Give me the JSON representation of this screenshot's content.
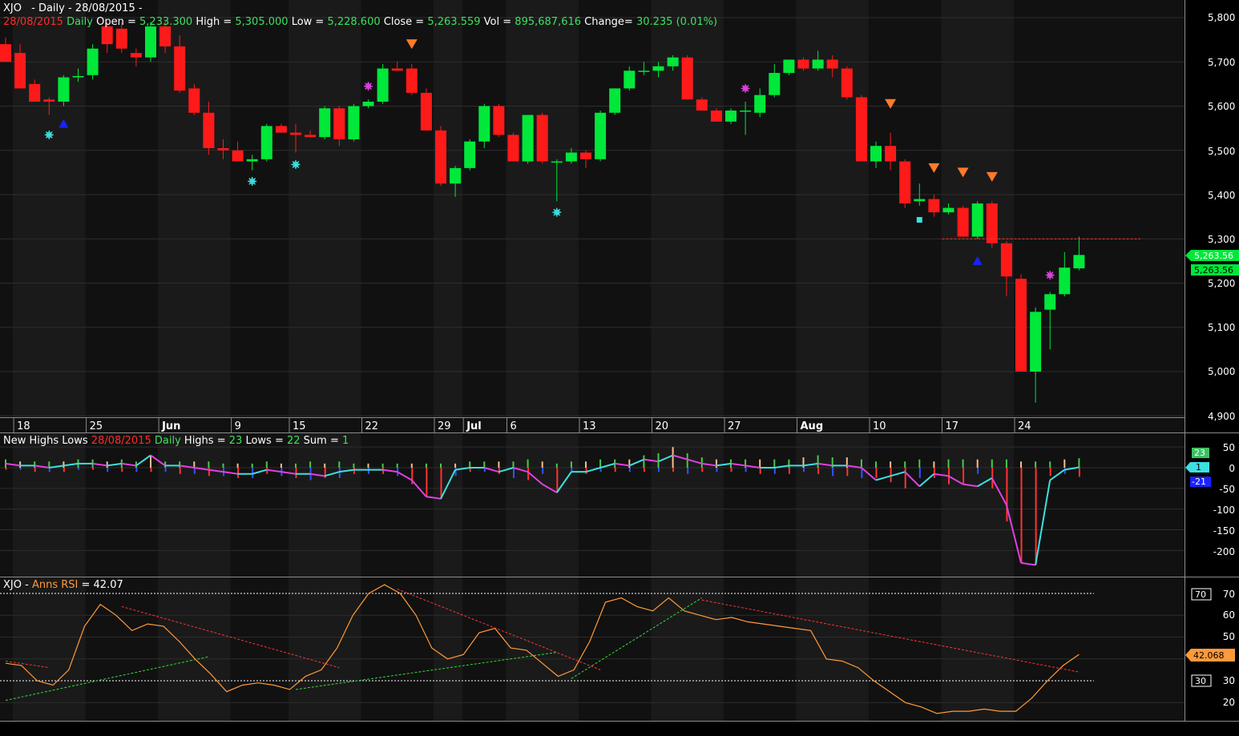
{
  "colors": {
    "background": "#000000",
    "panel_bg": "#111111",
    "stripe": "#1a1a1a",
    "border": "#8a8a8a",
    "grid": "#2d2d2d",
    "up": "#00e83a",
    "down": "#ff1a1a",
    "text": "#ffffff",
    "label_red": "#ff2a2a",
    "label_green": "#3ee060",
    "cyan": "#3de0e0",
    "magenta": "#e040e0",
    "orange": "#ff7a2a",
    "blue": "#1a22ff",
    "rsi_line": "#ff9a3a",
    "tick_pos": "#44cc44",
    "tick_neg": "#ff3333",
    "tick_peach": "#ffbb88",
    "tick_blue": "#3355ff"
  },
  "header": {
    "symbol": "XJO",
    "period": "- Daily - 28/08/2015 -"
  },
  "price_info": {
    "date": "28/08/2015",
    "interval": "Daily",
    "open_label": "Open =",
    "open": "5,233.300",
    "high_label": "High =",
    "high": "5,305.000",
    "low_label": "Low =",
    "low": "5,228.600",
    "close_label": "Close =",
    "close": "5,263.559",
    "vol_label": "Vol =",
    "vol": "895,687,616",
    "change_label": "Change=",
    "change": "30.235 (0.01%)"
  },
  "price_axis": {
    "ticks": [
      "5,800",
      "5,700",
      "5,600",
      "5,500",
      "5,400",
      "5,300",
      "5,200",
      "5,100",
      "5,000",
      "4,900"
    ],
    "last_badge_1": "5,263.56",
    "last_badge_2": "5,263.56"
  },
  "date_axis": [
    {
      "label": "18",
      "bar": 1,
      "bold": false
    },
    {
      "label": "25",
      "bar": 6,
      "bold": false
    },
    {
      "label": "Jun",
      "bar": 11,
      "bold": true
    },
    {
      "label": "9",
      "bar": 16,
      "bold": false
    },
    {
      "label": "15",
      "bar": 20,
      "bold": false
    },
    {
      "label": "22",
      "bar": 25,
      "bold": false
    },
    {
      "label": "29",
      "bar": 30,
      "bold": false
    },
    {
      "label": "Jul",
      "bar": 32,
      "bold": true
    },
    {
      "label": "6",
      "bar": 35,
      "bold": false
    },
    {
      "label": "13",
      "bar": 40,
      "bold": false
    },
    {
      "label": "20",
      "bar": 45,
      "bold": false
    },
    {
      "label": "27",
      "bar": 50,
      "bold": false
    },
    {
      "label": "Aug",
      "bar": 55,
      "bold": true
    },
    {
      "label": "10",
      "bar": 60,
      "bold": false
    },
    {
      "label": "17",
      "bar": 65,
      "bold": false
    },
    {
      "label": "24",
      "bar": 70,
      "bold": false
    }
  ],
  "highs_lows_panel": {
    "title": "New Highs Lows",
    "date": "28/08/2015",
    "interval": "Daily",
    "highs_label": "Highs =",
    "highs": "23",
    "lows_label": "Lows =",
    "lows": "22",
    "sum_label": "Sum =",
    "sum": "1",
    "axis_ticks": [
      "50",
      "0",
      "-50",
      "-100",
      "-150",
      "-200"
    ],
    "badge_highs": "23",
    "badge_sum": "1",
    "badge_lows": "-21"
  },
  "rsi_panel": {
    "symbol": "XJO",
    "title": "Anns RSI",
    "value_label": "= 42.07",
    "axis_ticks": [
      "70",
      "60",
      "50",
      "40",
      "30",
      "20"
    ],
    "badge_70": "70",
    "badge_30": "30",
    "badge_value": "42.068"
  },
  "chart_data": [
    {
      "type": "candlestick",
      "title": "XJO - Daily - 28/08/2015 -",
      "ylim": [
        4880,
        5830
      ],
      "fields": [
        "open",
        "high",
        "low",
        "close"
      ],
      "ohlc": [
        [
          5740,
          5755,
          5700,
          5700
        ],
        [
          5720,
          5740,
          5640,
          5640
        ],
        [
          5650,
          5660,
          5610,
          5610
        ],
        [
          5615,
          5620,
          5580,
          5610
        ],
        [
          5610,
          5670,
          5600,
          5665
        ],
        [
          5665,
          5685,
          5655,
          5668
        ],
        [
          5670,
          5740,
          5660,
          5730
        ],
        [
          5780,
          5790,
          5720,
          5740
        ],
        [
          5775,
          5790,
          5720,
          5730
        ],
        [
          5720,
          5730,
          5690,
          5710
        ],
        [
          5710,
          5790,
          5700,
          5780
        ],
        [
          5780,
          5795,
          5720,
          5735
        ],
        [
          5735,
          5760,
          5630,
          5635
        ],
        [
          5640,
          5650,
          5580,
          5585
        ],
        [
          5585,
          5610,
          5490,
          5505
        ],
        [
          5505,
          5525,
          5480,
          5500
        ],
        [
          5500,
          5520,
          5475,
          5475
        ],
        [
          5475,
          5490,
          5455,
          5480
        ],
        [
          5480,
          5560,
          5475,
          5555
        ],
        [
          5555,
          5560,
          5540,
          5540
        ],
        [
          5540,
          5560,
          5495,
          5535
        ],
        [
          5535,
          5545,
          5530,
          5530
        ],
        [
          5530,
          5600,
          5525,
          5595
        ],
        [
          5595,
          5600,
          5510,
          5525
        ],
        [
          5525,
          5605,
          5520,
          5600
        ],
        [
          5600,
          5615,
          5595,
          5610
        ],
        [
          5610,
          5695,
          5605,
          5685
        ],
        [
          5685,
          5700,
          5680,
          5680
        ],
        [
          5685,
          5695,
          5625,
          5630
        ],
        [
          5630,
          5640,
          5545,
          5545
        ],
        [
          5545,
          5555,
          5420,
          5425
        ],
        [
          5425,
          5465,
          5395,
          5460
        ],
        [
          5460,
          5525,
          5455,
          5520
        ],
        [
          5520,
          5605,
          5505,
          5600
        ],
        [
          5600,
          5605,
          5530,
          5535
        ],
        [
          5535,
          5540,
          5475,
          5475
        ],
        [
          5475,
          5580,
          5470,
          5580
        ],
        [
          5580,
          5585,
          5470,
          5475
        ],
        [
          5475,
          5480,
          5385,
          5475
        ],
        [
          5475,
          5505,
          5470,
          5495
        ],
        [
          5495,
          5500,
          5460,
          5480
        ],
        [
          5480,
          5590,
          5475,
          5585
        ],
        [
          5585,
          5640,
          5580,
          5640
        ],
        [
          5640,
          5690,
          5635,
          5680
        ],
        [
          5680,
          5700,
          5670,
          5680
        ],
        [
          5680,
          5700,
          5665,
          5690
        ],
        [
          5690,
          5715,
          5680,
          5710
        ],
        [
          5710,
          5715,
          5615,
          5615
        ],
        [
          5615,
          5620,
          5590,
          5590
        ],
        [
          5590,
          5595,
          5565,
          5565
        ],
        [
          5565,
          5595,
          5560,
          5590
        ],
        [
          5590,
          5610,
          5535,
          5590
        ],
        [
          5585,
          5640,
          5575,
          5625
        ],
        [
          5625,
          5695,
          5620,
          5675
        ],
        [
          5675,
          5705,
          5670,
          5705
        ],
        [
          5705,
          5710,
          5680,
          5685
        ],
        [
          5685,
          5725,
          5680,
          5705
        ],
        [
          5705,
          5715,
          5665,
          5685
        ],
        [
          5685,
          5690,
          5615,
          5620
        ],
        [
          5620,
          5625,
          5475,
          5475
        ],
        [
          5475,
          5520,
          5460,
          5510
        ],
        [
          5510,
          5540,
          5455,
          5475
        ],
        [
          5475,
          5480,
          5370,
          5380
        ],
        [
          5385,
          5425,
          5375,
          5390
        ],
        [
          5390,
          5400,
          5350,
          5360
        ],
        [
          5360,
          5380,
          5355,
          5370
        ],
        [
          5370,
          5375,
          5305,
          5305
        ],
        [
          5305,
          5385,
          5300,
          5380
        ],
        [
          5380,
          5385,
          5280,
          5290
        ],
        [
          5290,
          5295,
          5170,
          5215
        ],
        [
          5210,
          5220,
          5000,
          5000
        ],
        [
          5000,
          5145,
          4930,
          5135
        ],
        [
          5140,
          5180,
          5050,
          5175
        ],
        [
          5175,
          5270,
          5170,
          5235
        ],
        [
          5233.3,
          5305,
          5228.6,
          5263.559
        ]
      ],
      "markers": [
        {
          "bar": 3,
          "type": "asterisk",
          "color": "cyan",
          "price": 5535
        },
        {
          "bar": 4,
          "type": "triangle-up",
          "color": "blue",
          "price": 5560
        },
        {
          "bar": 17,
          "type": "asterisk",
          "color": "cyan",
          "price": 5430
        },
        {
          "bar": 20,
          "type": "asterisk",
          "color": "cyan",
          "price": 5468
        },
        {
          "bar": 25,
          "type": "asterisk",
          "color": "magenta",
          "price": 5645
        },
        {
          "bar": 28,
          "type": "triangle-down",
          "color": "orange",
          "price": 5740
        },
        {
          "bar": 38,
          "type": "asterisk",
          "color": "cyan",
          "price": 5360
        },
        {
          "bar": 51,
          "type": "asterisk",
          "color": "magenta",
          "price": 5640
        },
        {
          "bar": 61,
          "type": "triangle-down",
          "color": "orange",
          "price": 5605
        },
        {
          "bar": 63,
          "type": "square",
          "color": "cyan",
          "price": 5343
        },
        {
          "bar": 64,
          "type": "triangle-down",
          "color": "orange",
          "price": 5460
        },
        {
          "bar": 66,
          "type": "triangle-down",
          "color": "orange",
          "price": 5450
        },
        {
          "bar": 67,
          "type": "triangle-up",
          "color": "blue",
          "price": 5250
        },
        {
          "bar": 68,
          "type": "triangle-down",
          "color": "orange",
          "price": 5440
        },
        {
          "bar": 72,
          "type": "asterisk",
          "color": "magenta",
          "price": 5218
        }
      ],
      "reference_line": {
        "price": 5300,
        "from_bar": 65,
        "to_bar": 78,
        "style": "dashed",
        "color": "red"
      }
    },
    {
      "type": "line",
      "title": "New Highs Lows",
      "ylim": [
        -235,
        60
      ],
      "highs": [
        20,
        15,
        15,
        15,
        15,
        20,
        20,
        15,
        20,
        15,
        30,
        15,
        15,
        15,
        15,
        10,
        10,
        10,
        15,
        10,
        10,
        15,
        10,
        15,
        10,
        10,
        10,
        10,
        10,
        10,
        10,
        10,
        15,
        15,
        15,
        15,
        20,
        15,
        10,
        15,
        15,
        20,
        20,
        20,
        30,
        35,
        50,
        35,
        25,
        20,
        20,
        20,
        20,
        20,
        20,
        25,
        30,
        25,
        25,
        20,
        15,
        15,
        15,
        20,
        15,
        20,
        20,
        20,
        20,
        20,
        15,
        15,
        15,
        20,
        23
      ],
      "lows": [
        -5,
        -5,
        -10,
        -10,
        -10,
        -5,
        -5,
        -10,
        -10,
        -10,
        -10,
        -10,
        -15,
        -15,
        -20,
        -20,
        -25,
        -25,
        -15,
        -20,
        -25,
        -30,
        -25,
        -25,
        -15,
        -15,
        -15,
        -20,
        -40,
        -70,
        -75,
        -20,
        -10,
        -10,
        -15,
        -25,
        -30,
        -15,
        -60,
        -10,
        -15,
        -10,
        -10,
        -10,
        -10,
        -10,
        -10,
        -15,
        -10,
        -10,
        -10,
        -10,
        -15,
        -15,
        -15,
        -10,
        -15,
        -20,
        -20,
        -25,
        -25,
        -35,
        -50,
        -25,
        -25,
        -40,
        -40,
        -15,
        -50,
        -130,
        -230,
        -235,
        -20,
        -15,
        -22
      ],
      "sum": [
        10,
        5,
        5,
        0,
        5,
        10,
        10,
        5,
        10,
        5,
        30,
        5,
        5,
        0,
        -5,
        -10,
        -15,
        -15,
        -5,
        -10,
        -15,
        -15,
        -20,
        -10,
        -5,
        -5,
        -5,
        -10,
        -30,
        -70,
        -75,
        -5,
        0,
        0,
        -10,
        0,
        -10,
        -40,
        -60,
        -10,
        -10,
        0,
        10,
        5,
        20,
        15,
        30,
        20,
        10,
        5,
        10,
        5,
        0,
        0,
        5,
        5,
        10,
        5,
        5,
        0,
        -30,
        -20,
        -10,
        -45,
        -15,
        -20,
        -40,
        -45,
        -25,
        -90,
        -230,
        -235,
        -30,
        -5,
        1
      ]
    },
    {
      "type": "line",
      "title": "Anns RSI",
      "ylim": [
        14,
        73
      ],
      "values": [
        38,
        37,
        30,
        28,
        35,
        55,
        65,
        60,
        53,
        56,
        55,
        48,
        40,
        33,
        25,
        28,
        29,
        28,
        26,
        32,
        35,
        45,
        60,
        70,
        74,
        70,
        60,
        45,
        40,
        42,
        52,
        54,
        45,
        44,
        38,
        32,
        35,
        48,
        66,
        68,
        64,
        62,
        68,
        62,
        60,
        58,
        59,
        57,
        56,
        55,
        54,
        53,
        40,
        39,
        36,
        30,
        25,
        20,
        18,
        15,
        16,
        16,
        17,
        16,
        16,
        22,
        30,
        37,
        42.068
      ],
      "levels": [
        70,
        30
      ],
      "trendlines": [
        {
          "color": "red",
          "from": [
            0,
            39
          ],
          "to": [
            3,
            36
          ]
        },
        {
          "color": "green",
          "from": [
            0,
            21
          ],
          "to": [
            14,
            41
          ]
        },
        {
          "color": "red",
          "from": [
            8,
            64
          ],
          "to": [
            23,
            36
          ]
        },
        {
          "color": "green",
          "from": [
            20,
            26
          ],
          "to": [
            38,
            43
          ]
        },
        {
          "color": "red",
          "from": [
            27,
            72
          ],
          "to": [
            41,
            35
          ]
        },
        {
          "color": "green",
          "from": [
            39,
            31
          ],
          "to": [
            48,
            68
          ]
        },
        {
          "color": "red",
          "from": [
            48,
            67
          ],
          "to": [
            74,
            34
          ]
        }
      ]
    }
  ]
}
